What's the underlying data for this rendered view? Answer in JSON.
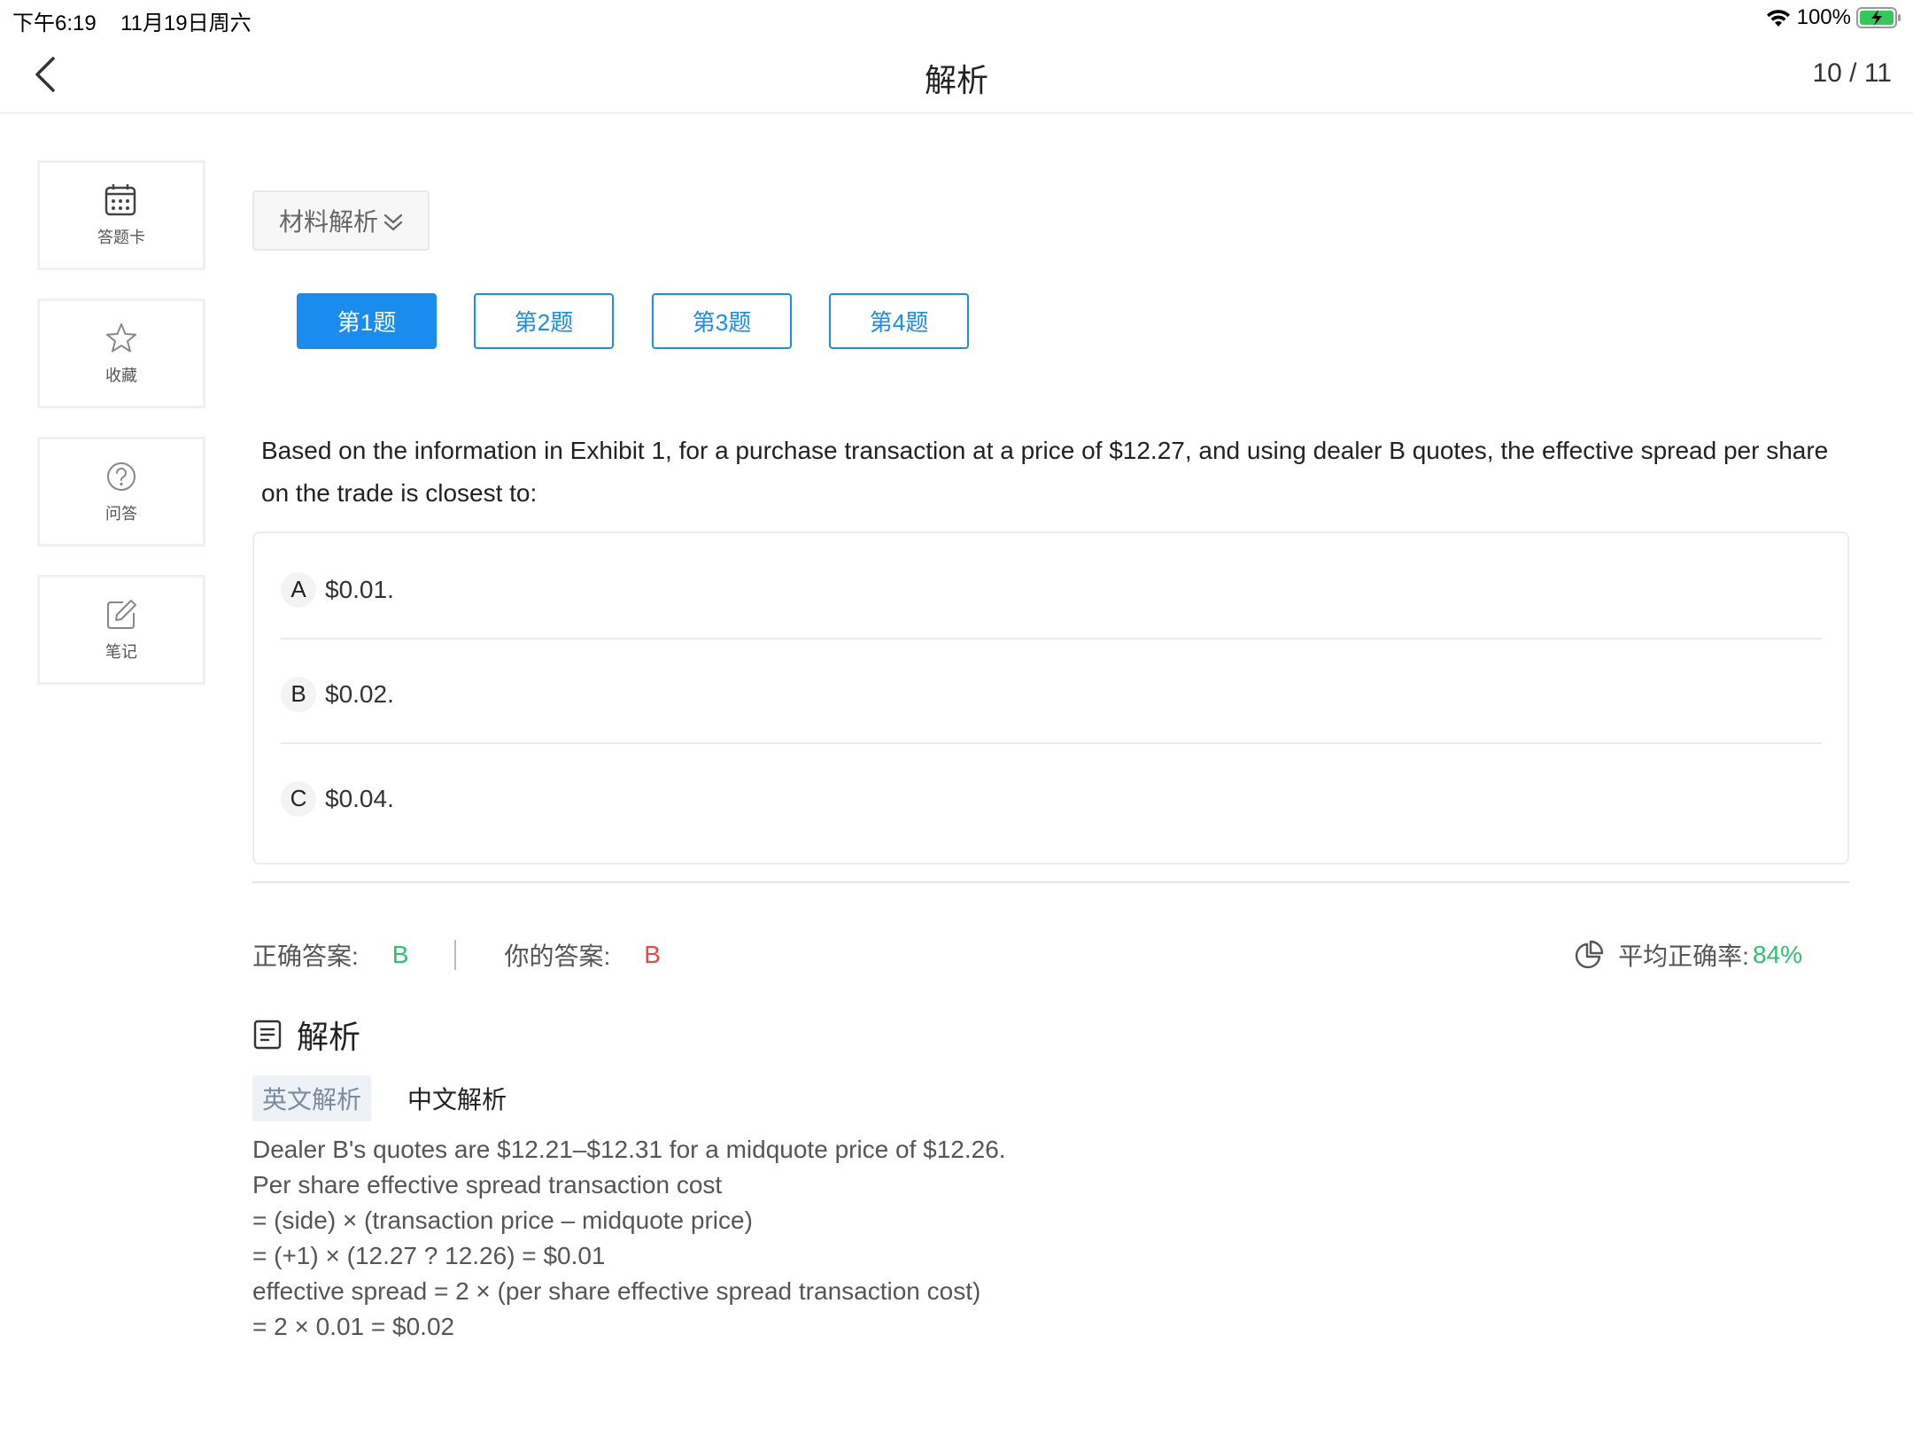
{
  "status_bar": {
    "time": "下午6:19",
    "date": "11月19日周六",
    "battery": "100%"
  },
  "nav": {
    "title": "解析",
    "counter": "10 / 11"
  },
  "sidebar": {
    "items": [
      {
        "label": "答题卡",
        "icon": "calendar-grid-icon"
      },
      {
        "label": "收藏",
        "icon": "star-icon"
      },
      {
        "label": "问答",
        "icon": "question-circle-icon"
      },
      {
        "label": "笔记",
        "icon": "edit-note-icon"
      }
    ]
  },
  "material": {
    "label": "材料解析"
  },
  "question_tabs": [
    {
      "label": "第1题",
      "active": true
    },
    {
      "label": "第2题",
      "active": false
    },
    {
      "label": "第3题",
      "active": false
    },
    {
      "label": "第4题",
      "active": false
    }
  ],
  "question": {
    "text": "Based on the information in Exhibit 1, for a purchase transaction at a price of $12.27, and using dealer B quotes, the effective spread per share on the trade is closest to:",
    "options": [
      {
        "letter": "A",
        "text": "$0.01."
      },
      {
        "letter": "B",
        "text": "$0.02."
      },
      {
        "letter": "C",
        "text": "$0.04."
      }
    ]
  },
  "answer": {
    "correct_label": "正确答案:",
    "correct_value": "B",
    "yours_label": "你的答案:",
    "yours_value": "B",
    "avg_label": "平均正确率:",
    "avg_value": "84%"
  },
  "analysis": {
    "title": "解析",
    "tab_en": "英文解析",
    "tab_zh": "中文解析",
    "lines": [
      "Dealer B's quotes are $12.21–$12.31 for a midquote price of $12.26.",
      "Per share effective spread transaction cost",
      "= (side) × (transaction price – midquote price)",
      "= (+1) × (12.27 ? 12.26) = $0.01",
      "effective spread = 2 × (per share effective spread transaction cost)",
      "= 2 × 0.01 = $0.02"
    ]
  },
  "colors": {
    "accent": "#1a8cf0",
    "correct": "#2fbf71",
    "wrong": "#e54b4b"
  }
}
